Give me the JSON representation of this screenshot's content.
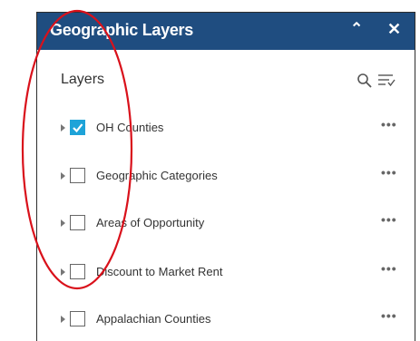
{
  "header": {
    "title": "Geographic Layers",
    "collapse_icon": "double-chevron-up-icon",
    "close_icon": "close-icon"
  },
  "layers_section": {
    "label": "Layers",
    "search_icon": "search-icon",
    "filter_icon": "filter-list-icon"
  },
  "layers": [
    {
      "label": "OH Counties",
      "checked": true
    },
    {
      "label": "Geographic Categories",
      "checked": false
    },
    {
      "label": "Areas of Opportunity",
      "checked": false
    },
    {
      "label": "Discount to Market Rent",
      "checked": false
    },
    {
      "label": "Appalachian Counties",
      "checked": false
    }
  ],
  "more_label": "•••",
  "colors": {
    "title_bar": "#1f4d80",
    "checkbox_checked": "#1ea3d8",
    "annotation_oval": "#d9111b"
  }
}
